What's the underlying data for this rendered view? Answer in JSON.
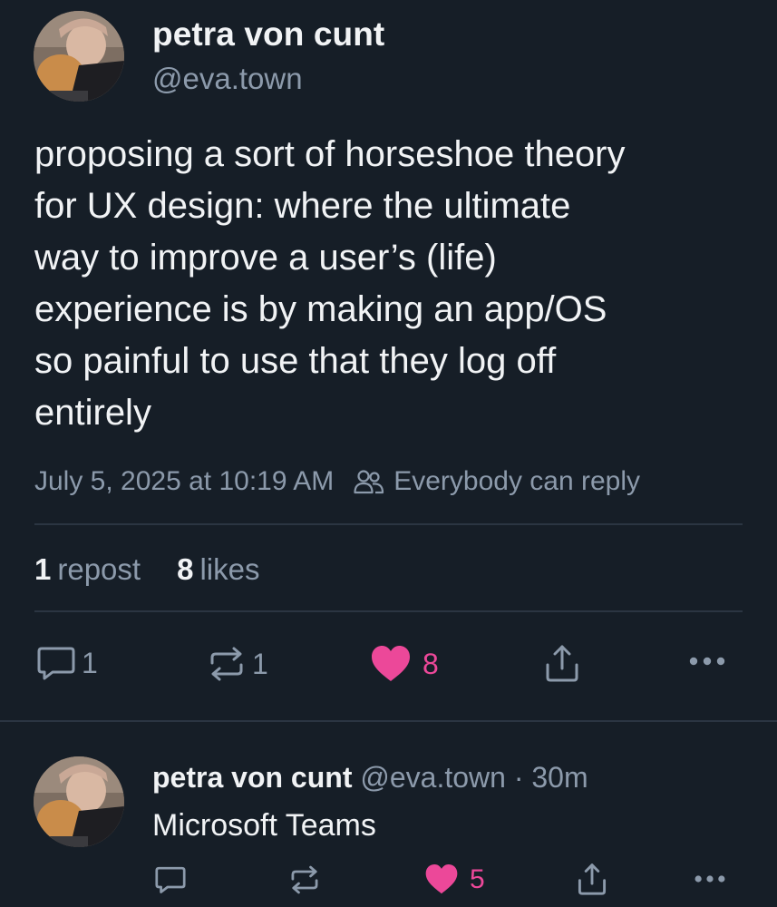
{
  "post": {
    "author_name": "petra von cunt",
    "author_handle": "@eva.town",
    "text": "proposing a sort of horseshoe theory\nfor UX design: where the ultimate\nway to improve a user’s (life)\nexperience is by making an app/OS\nso painful to use that they log off\nentirely",
    "timestamp": "July 5, 2025 at 10:19 AM",
    "reply_setting": "Everybody can reply",
    "stats": {
      "reposts_count": "1",
      "reposts_label": "repost",
      "likes_count": "8",
      "likes_label": "likes"
    },
    "actions": {
      "reply_count": "1",
      "repost_count": "1",
      "like_count": "8"
    }
  },
  "reply": {
    "author_name": "petra von cunt",
    "author_handle": "@eva.town",
    "separator": "·",
    "time_ago": "30m",
    "text": "Microsoft Teams",
    "actions": {
      "like_count": "5"
    }
  },
  "colors": {
    "background": "#161e27",
    "text_primary": "#f1f3f5",
    "text_secondary": "#8c9aab",
    "like_active": "#ec4899",
    "divider": "#2b3542"
  },
  "icons": [
    "reply-icon",
    "repost-icon",
    "heart-icon",
    "share-icon",
    "more-icon",
    "people-icon"
  ]
}
